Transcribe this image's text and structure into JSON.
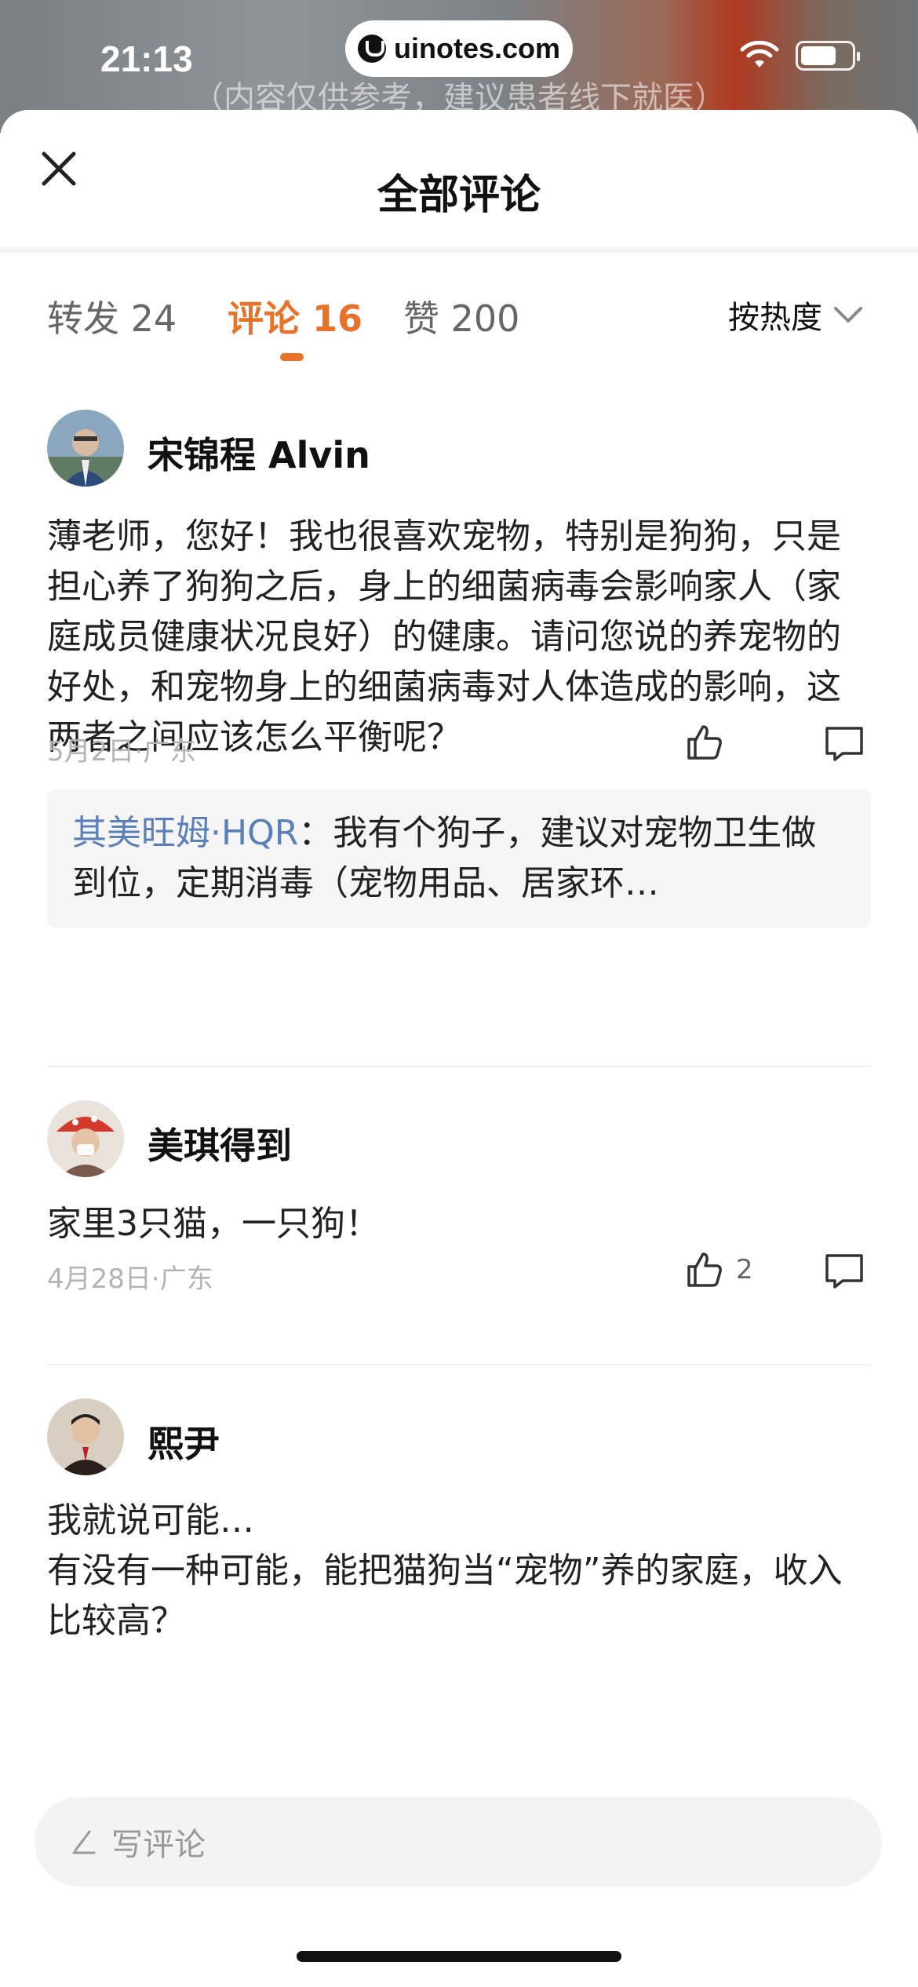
{
  "status_bar": {
    "time": "21:13",
    "url": "uinotes.com"
  },
  "video": {
    "caption": "（内容仅供参考，建议患者线下就医）"
  },
  "header": {
    "title": "全部评论"
  },
  "tabs": [
    {
      "label": "转发 24",
      "active": false
    },
    {
      "label": "评论 16",
      "active": true
    },
    {
      "label": "赞 200",
      "active": false
    }
  ],
  "sort": {
    "label": "按热度"
  },
  "comments": [
    {
      "author": "宋锦程 Alvin",
      "text": "薄老师，您好！我也很喜欢宠物，特别是狗狗，只是担心养了狗狗之后，身上的细菌病毒会影响家人（家庭成员健康状况良好）的健康。请问您说的养宠物的好处，和宠物身上的细菌病毒对人体造成的影响，这两者之间应该怎么平衡呢？",
      "meta": "5月2日·广东",
      "likes": "",
      "reply": {
        "author": "其美旺姆·HQR",
        "text": "：我有个狗子，建议对宠物卫生做到位，定期消毒（宠物用品、居家环…"
      }
    },
    {
      "author": "美琪得到",
      "text": "家里3只猫，一只狗！",
      "meta": "4月28日·广东",
      "likes": "2"
    },
    {
      "author": "熙尹",
      "text_line1": "我就说可能…",
      "text_line2": "有没有一种可能，能把猫狗当“宠物”养的家庭，收入比较高？"
    }
  ],
  "input": {
    "placeholder": "写评论"
  },
  "colors": {
    "accent": "#e8722a",
    "reply_author": "#5b7fb8"
  }
}
